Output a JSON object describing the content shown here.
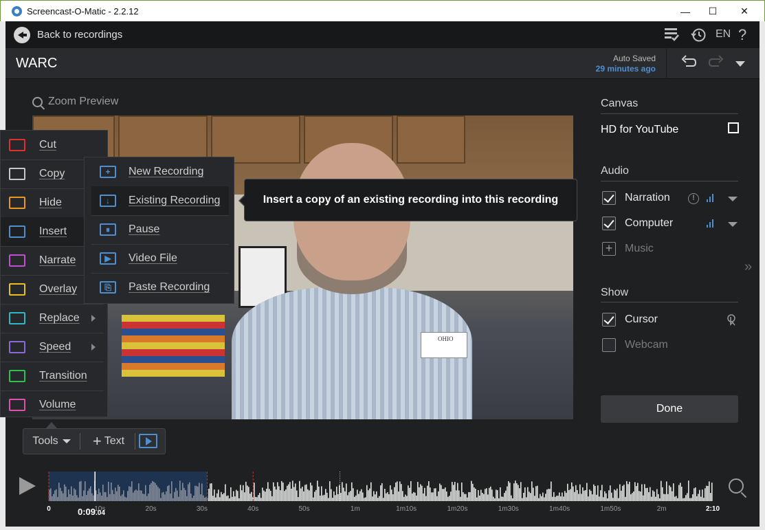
{
  "window": {
    "title": "Screencast-O-Matic - 2.2.12",
    "minimize_glyph": "—",
    "maximize_glyph": "☐",
    "close_glyph": "✕"
  },
  "backbar": {
    "back_label": "Back to recordings",
    "language": "EN",
    "help_glyph": "?",
    "icons": [
      "back-arrow-icon",
      "checklist-icon",
      "history-icon",
      "help-icon"
    ]
  },
  "project": {
    "title": "WARC",
    "autosave_label": "Auto Saved",
    "autosave_ago": "29 minutes ago"
  },
  "preview": {
    "zoom_label": "Zoom Preview",
    "badge_text": "OHIO"
  },
  "tools_menu": {
    "items": [
      {
        "label": "Cut",
        "icon": "scissors-icon",
        "color": "#e03030"
      },
      {
        "label": "Copy",
        "icon": "copy-icon",
        "color": "#c8c8c8"
      },
      {
        "label": "Hide",
        "icon": "hide-eye-icon",
        "color": "#e89a20"
      },
      {
        "label": "Insert",
        "icon": "insert-icon",
        "color": "#4f8fd0"
      },
      {
        "label": "Narrate",
        "icon": "narrate-icon",
        "color": "#c050d0"
      },
      {
        "label": "Overlay",
        "icon": "overlay-icon",
        "color": "#e8c020"
      },
      {
        "label": "Replace",
        "icon": "replace-icon",
        "color": "#30b8c8"
      },
      {
        "label": "Speed",
        "icon": "speed-icon",
        "color": "#8a6ad8"
      },
      {
        "label": "Transition",
        "icon": "transition-icon",
        "color": "#30c050"
      },
      {
        "label": "Volume",
        "icon": "volume-icon",
        "color": "#e050b0"
      }
    ]
  },
  "insert_menu": {
    "items": [
      {
        "label": "New Recording",
        "icon": "new-recording-icon",
        "glyph": "+"
      },
      {
        "label": "Existing Recording",
        "icon": "existing-recording-icon",
        "glyph": "↓"
      },
      {
        "label": "Pause",
        "icon": "pause-icon",
        "glyph": "⏸"
      },
      {
        "label": "Video File",
        "icon": "video-file-icon",
        "glyph": "▶"
      },
      {
        "label": "Paste Recording",
        "icon": "paste-recording-icon",
        "glyph": "⎘"
      }
    ]
  },
  "tooltip": {
    "text": "Insert a copy of an existing recording into this recording"
  },
  "toolbar": {
    "tools_label": "Tools",
    "text_label": "Text",
    "text_plus": "+"
  },
  "panel": {
    "canvas": {
      "title": "Canvas",
      "hd_label": "HD for YouTube",
      "hd_checked": false
    },
    "audio": {
      "title": "Audio",
      "narration": {
        "label": "Narration",
        "checked": true,
        "info_glyph": "!"
      },
      "computer": {
        "label": "Computer",
        "checked": true
      },
      "music": {
        "label": "Music",
        "checked": false,
        "plus_glyph": "+"
      }
    },
    "show": {
      "title": "Show",
      "cursor": {
        "label": "Cursor",
        "checked": true
      },
      "webcam": {
        "label": "Webcam",
        "checked": false
      }
    },
    "done_label": "Done",
    "expand_glyph": "»"
  },
  "timeline": {
    "current_time_main": "0:09",
    "current_time_frac": ".04",
    "ticks": [
      "0",
      "10s",
      "20s",
      "30s",
      "40s",
      "50s",
      "1m",
      "1m10s",
      "1m20s",
      "1m30s",
      "1m40s",
      "1m50s",
      "2m",
      "2:10"
    ],
    "total_seconds": 130,
    "playhead_seconds": 9.04,
    "selection_seconds": [
      0,
      31
    ],
    "marker_seconds": [
      0,
      31,
      40
    ],
    "dotted_marker_seconds": 57
  },
  "colors": {
    "accent_blue": "#4f8fd0",
    "marker_red": "#c0302a",
    "window_border": "#6a9a3a"
  }
}
